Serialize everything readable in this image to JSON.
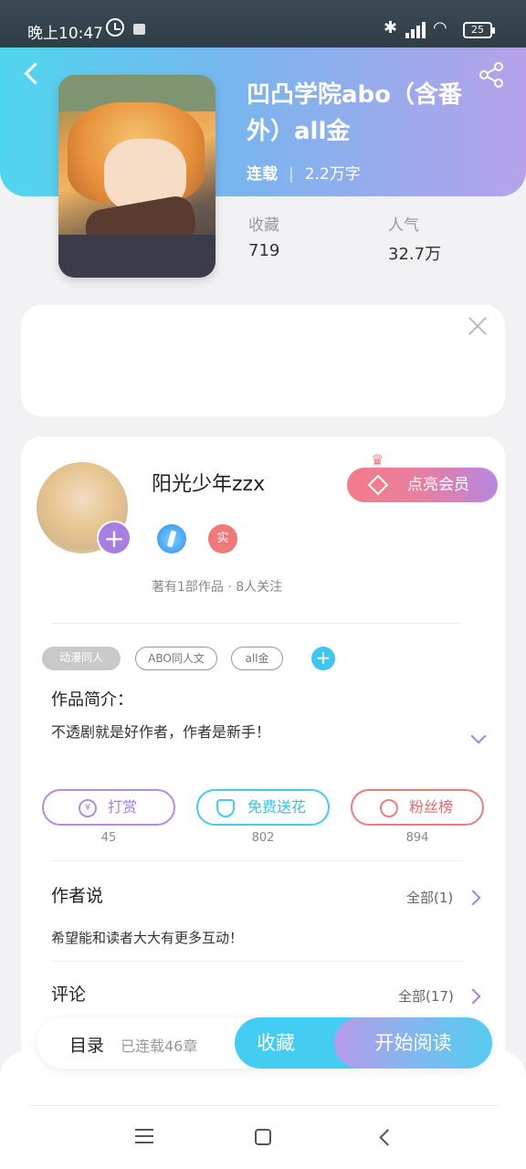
{
  "status_bar": {
    "time": "晚上10:47",
    "battery": "25"
  },
  "book": {
    "title": "凹凸学院abo（含番外）all金",
    "status": "连载",
    "word_count": "2.2万字",
    "collect_label": "收藏",
    "collect_value": "719",
    "popularity_label": "人气",
    "popularity_value": "32.7万"
  },
  "author": {
    "name": "阳光少年zzx",
    "real_badge": "实",
    "meta": "著有1部作品 · 8人关注",
    "member_button": "点亮会员"
  },
  "tags": [
    "动漫同人",
    "ABO同人文",
    "all金"
  ],
  "intro": {
    "title": "作品简介：",
    "text": "不透剧就是好作者，作者是新手！"
  },
  "actions": [
    {
      "label": "打赏",
      "count": "45",
      "icon": "yen-icon",
      "color": "#b18de0"
    },
    {
      "label": "免费送花",
      "count": "802",
      "icon": "flower-icon",
      "color": "#43cdf2"
    },
    {
      "label": "粉丝榜",
      "count": "894",
      "icon": "fan-icon",
      "color": "#ef7b7b"
    }
  ],
  "author_say": {
    "title": "作者说",
    "more": "全部(1)",
    "text": "希望能和读者大大有更多互动！"
  },
  "comments": {
    "title": "评论",
    "more": "全部(17)"
  },
  "bottom": {
    "toc": "目录",
    "toc_status": "已连载46章",
    "collect": "收藏",
    "read": "开始阅读"
  },
  "colors": {
    "accent_blue": "#43cdf2",
    "accent_purple": "#a77fe0",
    "accent_pink": "#f47c8a"
  }
}
